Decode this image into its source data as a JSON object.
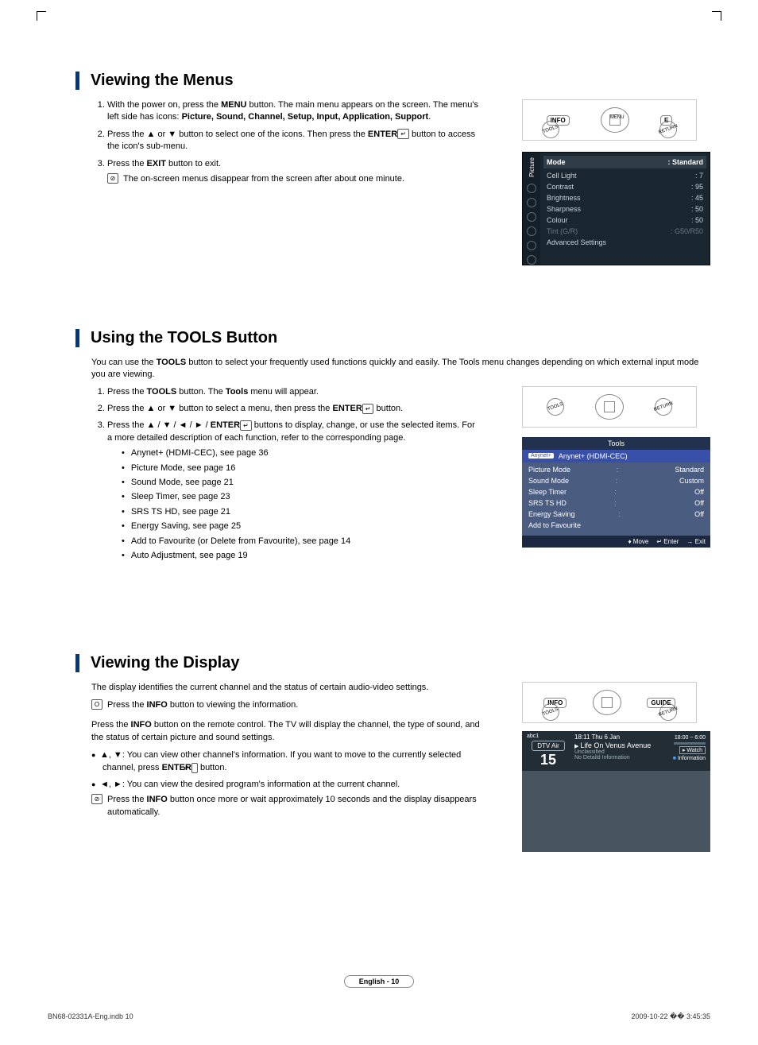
{
  "section1": {
    "heading": "Viewing the Menus",
    "step1_a": "With the power on, press the ",
    "step1_b": "MENU",
    "step1_c": " button. The main menu appears on the screen. The menu's left side has icons: ",
    "step1_d": "Picture, Sound, Channel, Setup, Input, Application, Support",
    "step1_e": ".",
    "step2_a": "Press the ▲ or ▼ button to select one of the icons. Then press the ",
    "step2_b": "ENTER",
    "step2_c": " button to access the icon's sub-menu.",
    "step3_a": "Press the ",
    "step3_b": "EXIT",
    "step3_c": " button to exit.",
    "note": "The on-screen menus disappear from the screen after about one minute."
  },
  "remote1": {
    "info": "INFO",
    "menu": "MENU",
    "e": "E",
    "tools": "TOOLS",
    "return": "RETURN",
    "guide": "GUIDE"
  },
  "picture_menu": {
    "tab": "Picture",
    "rows": [
      {
        "k": "Mode",
        "v": ": Standard",
        "hi": true
      },
      {
        "k": "Cell Light",
        "v": ": 7"
      },
      {
        "k": "Contrast",
        "v": ": 95"
      },
      {
        "k": "Brightness",
        "v": ": 45"
      },
      {
        "k": "Sharpness",
        "v": ": 50"
      },
      {
        "k": "Colour",
        "v": ": 50"
      },
      {
        "k": "Tint (G/R)",
        "v": ": G50/R50",
        "dim": true
      },
      {
        "k": "Advanced Settings",
        "v": ""
      }
    ]
  },
  "section2": {
    "heading": "Using the TOOLS Button",
    "intro_a": "You can use the ",
    "intro_b": "TOOLS",
    "intro_c": " button to select your frequently used functions quickly and easily. The Tools menu changes depending on which external input mode you are viewing.",
    "step1_a": "Press the ",
    "step1_b": "TOOLS",
    "step1_c": " button. The ",
    "step1_d": "Tools",
    "step1_e": " menu will appear.",
    "step2_a": "Press the ▲ or ▼ button to select a menu, then press the ",
    "step2_b": "ENTER",
    "step2_c": " button.",
    "step3_a": "Press the ▲ / ▼ / ◄ / ► / ",
    "step3_b": "ENTER",
    "step3_c": " buttons to display, change, or use the selected items. For a more detailed description of each function, refer to the corresponding page.",
    "bullets": [
      "Anynet+ (HDMI-CEC), see page 36",
      "Picture Mode, see page 16",
      "Sound Mode, see page 21",
      "Sleep Timer, see page 23",
      "SRS TS HD, see page 21",
      "Energy Saving, see page 25",
      "Add to Favourite (or Delete from Favourite), see page 14",
      "Auto Adjustment, see page 19"
    ]
  },
  "tools_menu": {
    "title": "Tools",
    "highlight": "Anynet+ (HDMI-CEC)",
    "rows": [
      {
        "k": "Picture Mode",
        "v": "Standard"
      },
      {
        "k": "Sound Mode",
        "v": "Custom"
      },
      {
        "k": "Sleep Timer",
        "v": "Off"
      },
      {
        "k": "SRS TS HD",
        "v": "Off"
      },
      {
        "k": "Energy Saving",
        "v": "Off"
      },
      {
        "k": "Add to Favourite",
        "v": ""
      }
    ],
    "footer": {
      "move": "Move",
      "enter": "Enter",
      "exit": "Exit"
    }
  },
  "section3": {
    "heading": "Viewing the Display",
    "intro": "The display identifies the current channel and the status of certain audio-video settings.",
    "note1_a": "Press the ",
    "note1_b": "INFO",
    "note1_c": " button to viewing the information.",
    "para_a": "Press the ",
    "para_b": "INFO",
    "para_c": " button on the remote control. The TV will display the channel, the type of sound, and the status of certain picture and sound settings.",
    "b1_a": "▲, ▼: You can view other channel's information. If you want to move to the currently selected channel, press ",
    "b1_b": "ENTER",
    "b1_c": " button.",
    "b2": "◄, ►: You can view the desired program's information at the current channel.",
    "note2_a": "Press the ",
    "note2_b": "INFO",
    "note2_c": " button once more or wait approximately 10 seconds and the display disappears automatically."
  },
  "info_display": {
    "ch_name": "abc1",
    "ch_type": "DTV Air",
    "ch_num": "15",
    "datetime": "18:11 Thu 6 Jan",
    "program": "Life On Venus Avenue",
    "sub1": "Unclassified",
    "sub2": "No Detaild Information",
    "range": "18:00 ~ 6:00",
    "watch": "Watch",
    "information": "Information"
  },
  "footer": {
    "page": "English - 10",
    "docref": "BN68-02331A-Eng.indb   10",
    "timestamp": "2009-10-22   �� 3:45:35"
  }
}
